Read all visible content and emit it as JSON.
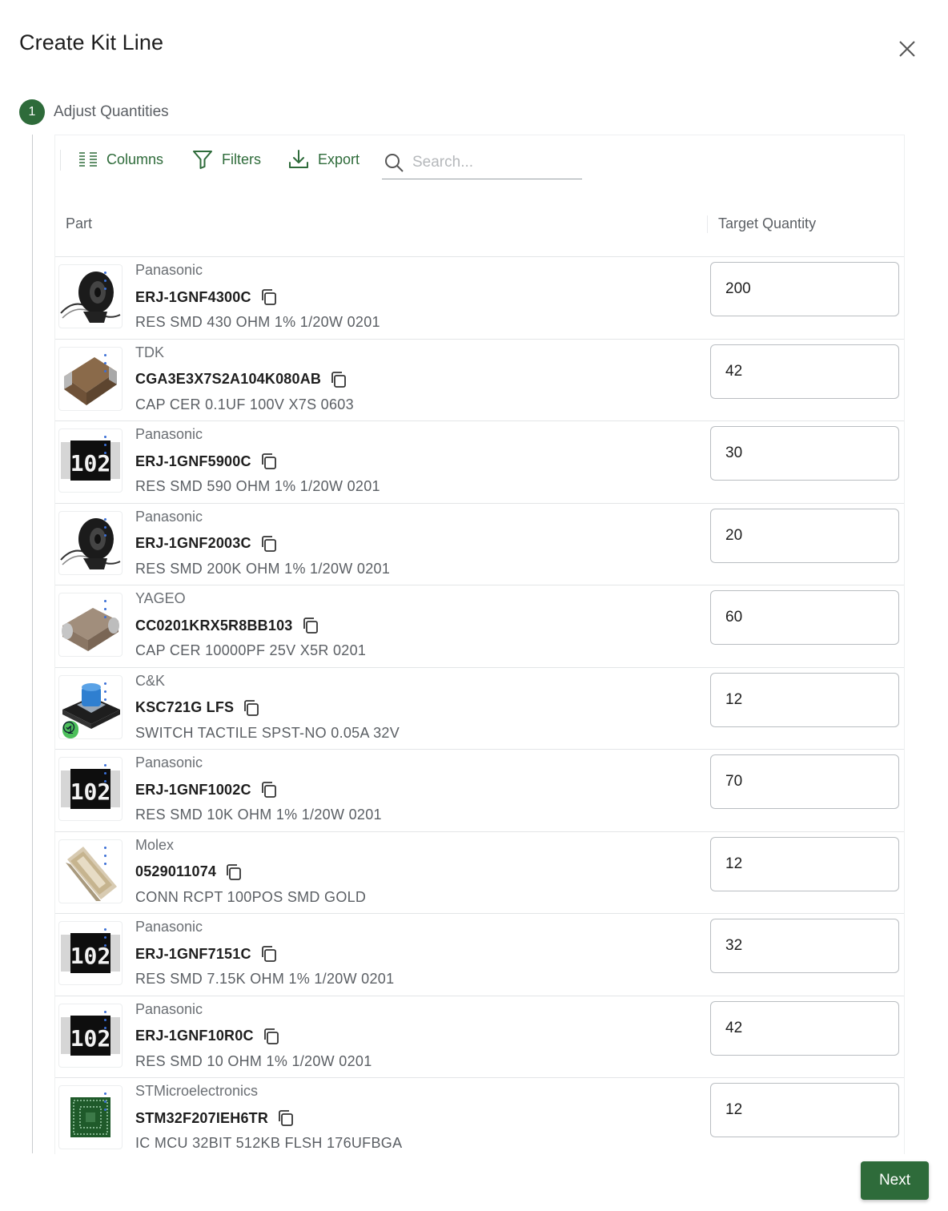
{
  "dialog": {
    "title": "Create Kit Line",
    "next_label": "Next"
  },
  "step": {
    "number": "1",
    "label": "Adjust Quantities"
  },
  "toolbar": {
    "columns_label": "Columns",
    "filters_label": "Filters",
    "export_label": "Export",
    "search_placeholder": "Search..."
  },
  "table": {
    "columns": [
      "Part",
      "Target Quantity"
    ],
    "rows": [
      {
        "manufacturer": "Panasonic",
        "part_number": "ERJ-1GNF4300C",
        "description": "RES SMD 430 OHM 1% 1/20W 0201",
        "target_quantity": "200",
        "image": "reel"
      },
      {
        "manufacturer": "TDK",
        "part_number": "CGA3E3X7S2A104K080AB",
        "description": "CAP CER 0.1UF 100V X7S 0603",
        "target_quantity": "42",
        "image": "mlcc-brown"
      },
      {
        "manufacturer": "Panasonic",
        "part_number": "ERJ-1GNF5900C",
        "description": "RES SMD 590 OHM 1% 1/20W 0201",
        "target_quantity": "30",
        "image": "resistor-102"
      },
      {
        "manufacturer": "Panasonic",
        "part_number": "ERJ-1GNF2003C",
        "description": "RES SMD 200K OHM 1% 1/20W 0201",
        "target_quantity": "20",
        "image": "reel"
      },
      {
        "manufacturer": "YAGEO",
        "part_number": "CC0201KRX5R8BB103",
        "description": "CAP CER 10000PF 25V X5R 0201",
        "target_quantity": "60",
        "image": "mlcc-taupe"
      },
      {
        "manufacturer": "C&K",
        "part_number": "KSC721G LFS",
        "description": "SWITCH TACTILE SPST-NO 0.05A 32V",
        "target_quantity": "12",
        "image": "switch",
        "badge": "1"
      },
      {
        "manufacturer": "Panasonic",
        "part_number": "ERJ-1GNF1002C",
        "description": "RES SMD 10K OHM 1% 1/20W 0201",
        "target_quantity": "70",
        "image": "resistor-102"
      },
      {
        "manufacturer": "Molex",
        "part_number": "0529011074",
        "description": "CONN RCPT 100POS SMD GOLD",
        "target_quantity": "12",
        "image": "connector"
      },
      {
        "manufacturer": "Panasonic",
        "part_number": "ERJ-1GNF7151C",
        "description": "RES SMD 7.15K OHM 1% 1/20W 0201",
        "target_quantity": "32",
        "image": "resistor-102"
      },
      {
        "manufacturer": "Panasonic",
        "part_number": "ERJ-1GNF10R0C",
        "description": "RES SMD 10 OHM 1% 1/20W 0201",
        "target_quantity": "42",
        "image": "resistor-102"
      },
      {
        "manufacturer": "STMicroelectronics",
        "part_number": "STM32F207IEH6TR",
        "description": "IC MCU 32BIT 512KB FLSH 176UFBGA",
        "target_quantity": "12",
        "image": "bga-chip"
      }
    ]
  },
  "resistor_marking": "102",
  "colors": {
    "accent": "#2e6b3a",
    "badge_green": "#4cbf5a",
    "row_dots": "#3b6fd6"
  },
  "icons": [
    "close-icon",
    "columns-icon",
    "filter-icon",
    "export-icon",
    "search-icon",
    "copy-icon",
    "check-circle-icon"
  ]
}
